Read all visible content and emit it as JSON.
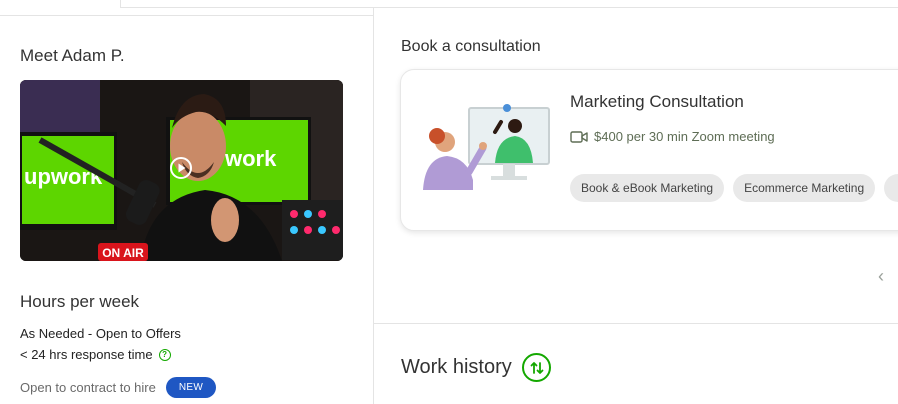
{
  "profile": {
    "meet_title": "Meet Adam P.",
    "video": {
      "brand_text_left": "upwork",
      "brand_text_right": "work",
      "sign_text": "ON AIR"
    },
    "hours": {
      "title": "Hours per week",
      "availability": "As Needed - Open to Offers",
      "response": "< 24 hrs response time",
      "contract": "Open to contract to hire",
      "badge": "NEW"
    }
  },
  "consultation": {
    "section_title": "Book a consultation",
    "title": "Marketing Consultation",
    "meta": "$400 per 30 min Zoom meeting",
    "tags": [
      "Book & eBook Marketing",
      "Ecommerce Marketing"
    ]
  },
  "work_history": {
    "title": "Work history"
  },
  "colors": {
    "accent_green": "#14a800",
    "badge_blue": "#1f57c3"
  },
  "icons": {
    "play": "play-icon",
    "video_camera": "video-camera-icon",
    "question": "question-icon",
    "chevron_left": "chevron-left-icon",
    "sort": "sort-icon"
  }
}
